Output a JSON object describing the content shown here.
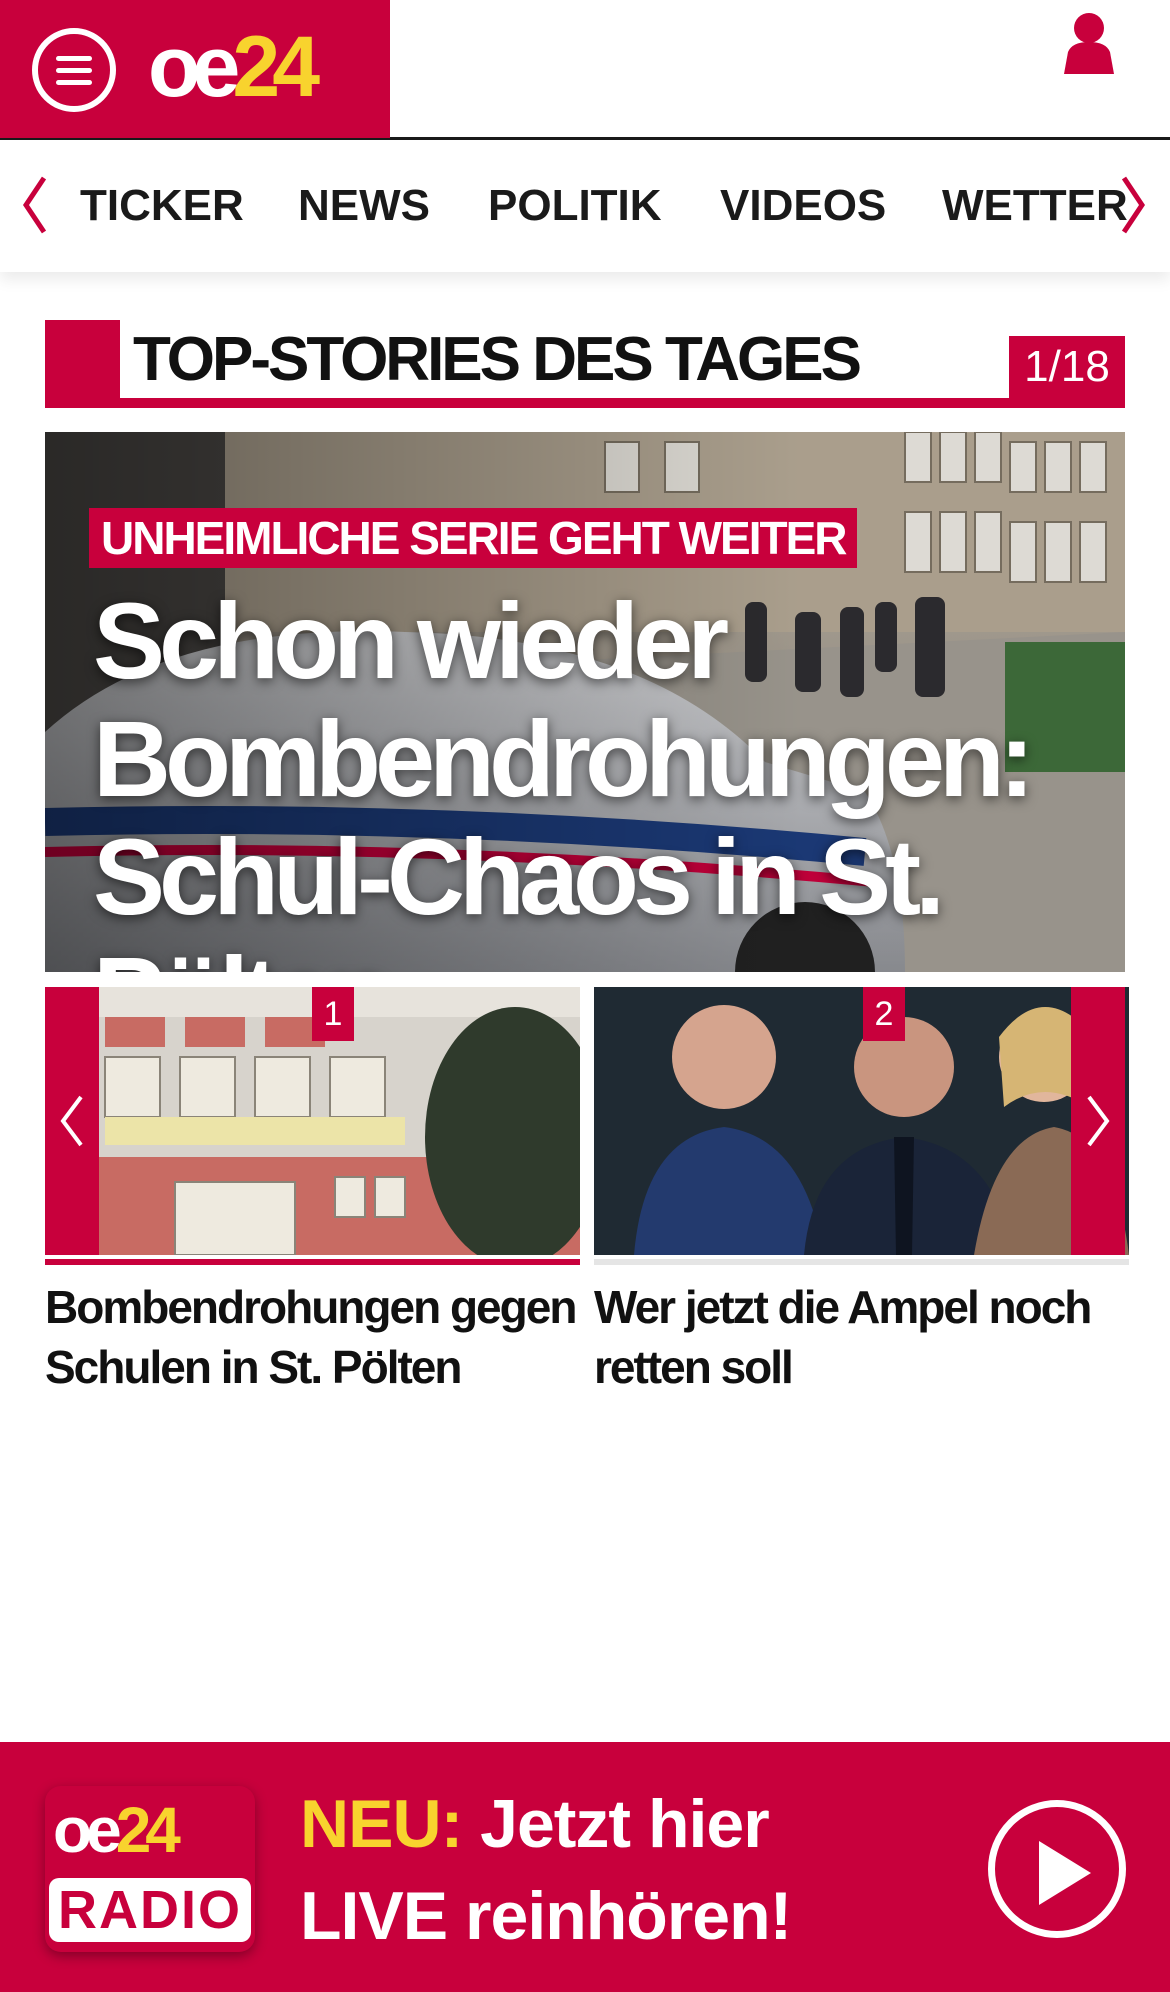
{
  "header": {
    "logo": {
      "part1": "oe",
      "part2": "24"
    },
    "icons": {
      "menu": "hamburger-menu-icon",
      "user": "user-account-icon"
    },
    "colors": {
      "brand": "#c8003c",
      "accent_yellow": "#f8d32e"
    }
  },
  "nav": {
    "items": [
      {
        "label": "TICKER"
      },
      {
        "label": "NEWS"
      },
      {
        "label": "POLITIK"
      },
      {
        "label": "VIDEOS"
      },
      {
        "label": "WETTER"
      }
    ]
  },
  "section": {
    "title": "TOP-STORIES DES TAGES",
    "pager": "1/18"
  },
  "hero": {
    "kicker": "UNHEIMLICHE SERIE GEHT WEITER",
    "headline": "Schon wieder Bombendrohungen: Schul-Chaos in St. Pölten"
  },
  "teasers": [
    {
      "number": "1",
      "title": "Bombendrohungen gegen Schulen in St. Pölten"
    },
    {
      "number": "2",
      "title": "Wer jetzt die Ampel noch retten soll"
    }
  ],
  "radio": {
    "logo": {
      "part1": "oe",
      "part2": "24",
      "plate": "RADIO"
    },
    "neu": "NEU:",
    "line1": "Jetzt hier",
    "line2": "LIVE reinhören!"
  }
}
